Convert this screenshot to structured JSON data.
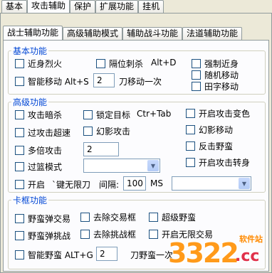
{
  "main_tabs": [
    "基本",
    "攻击辅助",
    "保护",
    "扩展功能",
    "挂机"
  ],
  "sub_tabs": [
    "战士辅助功能",
    "高级辅助模式",
    "辅助战斗功能",
    "法道辅助功能"
  ],
  "basic": {
    "legend": "基本功能",
    "fire": "近身烈火",
    "teleport_cut": "隔位刺杀",
    "teleport_hotkey": "Alt+D",
    "force_close": "强制近身",
    "smart_move": "智能移动 Alt+S",
    "smart_move_value": "2",
    "knife_move": "刀移动一次",
    "random_move": "随机移动",
    "tian_move": "田字移动"
  },
  "advanced": {
    "legend": "高级功能",
    "attack_stealth": "攻击暗杀",
    "lock_target": "锁定目标",
    "lock_hotkey": "Ctr+Tab",
    "attack_color": "开启攻击变色",
    "overspeed": "过攻击超速",
    "phantom_attack": "幻影攻击",
    "phantom_move": "幻影移动",
    "multi_attack": "多倍攻击",
    "multi_value": "2",
    "counter_savage": "反击野蛮",
    "filter_mode": "过篮模式",
    "attack_turn": "开启攻击转身",
    "enable_label": "开启",
    "key_label": "`键无限刀",
    "interval_label": "间隔:",
    "interval_value": "100",
    "ms_label": "MS"
  },
  "stuck": {
    "legend": "卡框功能",
    "savage_trade": "野蛮弹交易",
    "remove_trade": "去除交易框",
    "super_savage": "超级野蛮",
    "savage_challenge": "野蛮弹挑战",
    "remove_challenge": "去除挑战框",
    "enable_unlimited": "开启无限交易",
    "smart_savage": "智能野蛮 ALT+G",
    "smart_savage_value": "2",
    "knife_savage": "刀野蛮一次"
  },
  "watermark": {
    "site": "软件站",
    "brand": "3322",
    "tld": ".cc"
  }
}
